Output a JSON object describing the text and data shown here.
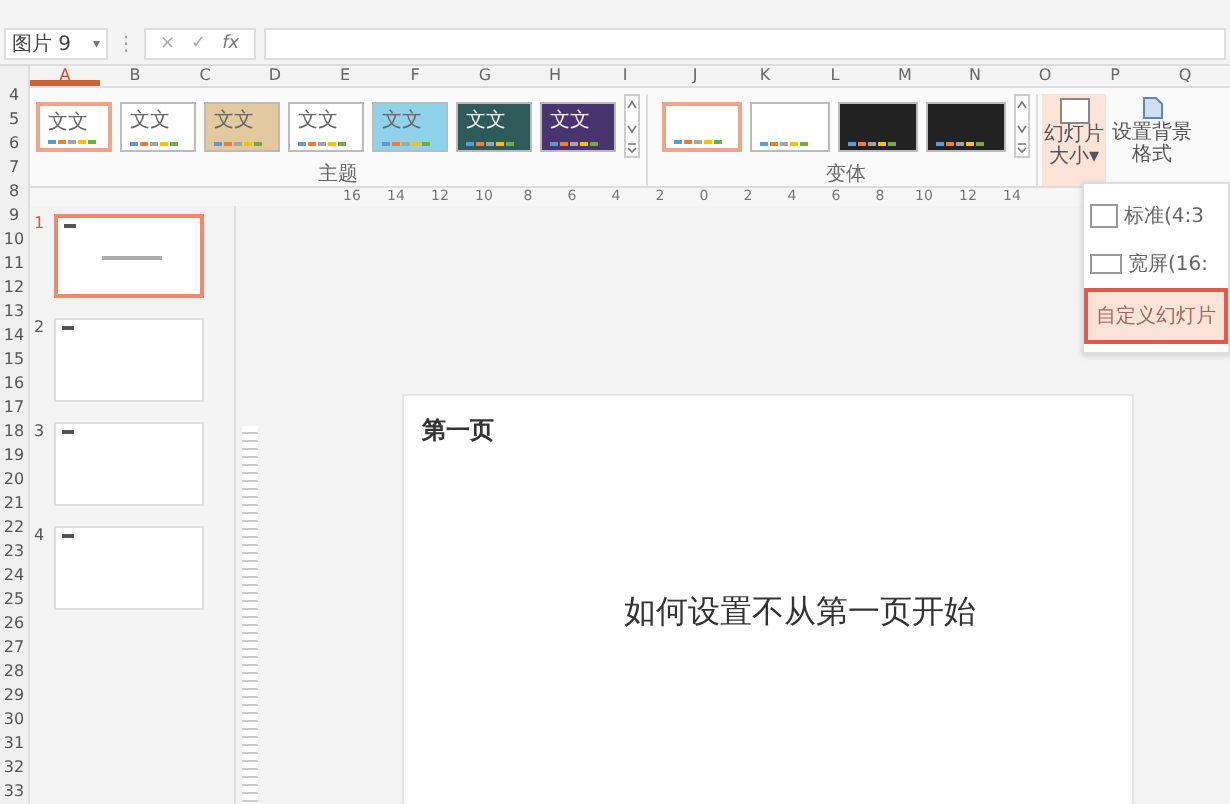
{
  "formula_bar": {
    "name_box": "图片 9",
    "name_box_caret": "▾",
    "separator": "⋮",
    "cancel": "×",
    "confirm": "✓",
    "function": "fx"
  },
  "columns": [
    {
      "label": "A",
      "selected": true
    },
    {
      "label": "B",
      "selected": false
    },
    {
      "label": "C",
      "selected": false
    },
    {
      "label": "D",
      "selected": false
    },
    {
      "label": "E",
      "selected": false
    },
    {
      "label": "F",
      "selected": false
    },
    {
      "label": "G",
      "selected": false
    },
    {
      "label": "H",
      "selected": false
    },
    {
      "label": "I",
      "selected": false
    },
    {
      "label": "J",
      "selected": false
    },
    {
      "label": "K",
      "selected": false
    },
    {
      "label": "L",
      "selected": false
    },
    {
      "label": "M",
      "selected": false
    },
    {
      "label": "N",
      "selected": false
    },
    {
      "label": "O",
      "selected": false
    },
    {
      "label": "P",
      "selected": false
    },
    {
      "label": "Q",
      "selected": false
    }
  ],
  "rows": [
    "4",
    "5",
    "6",
    "7",
    "8",
    "9",
    "10",
    "11",
    "12",
    "13",
    "14",
    "15",
    "16",
    "17",
    "18",
    "19",
    "20",
    "21",
    "22",
    "23",
    "24",
    "25",
    "26",
    "27",
    "28",
    "29",
    "30",
    "31",
    "32",
    "33"
  ],
  "themes": {
    "label": "主题",
    "items": [
      {
        "text": "文文",
        "color": "#ffffff",
        "selected": true
      },
      {
        "text": "文文",
        "color": "#ffffff",
        "selected": false
      },
      {
        "text": "文文",
        "color": "#e2c9a0",
        "selected": false
      },
      {
        "text": "文文",
        "color": "#ffffff",
        "selected": false
      },
      {
        "text": "文文",
        "color": "#8fd3ea",
        "selected": false
      },
      {
        "text": "文文",
        "color": "#2f5a5a",
        "selected": false
      },
      {
        "text": "文文",
        "color": "#4a3470",
        "selected": false
      }
    ]
  },
  "variants": {
    "label": "变体",
    "items": [
      {
        "color": "#ffffff",
        "selected": true
      },
      {
        "color": "#ffffff",
        "selected": false
      },
      {
        "color": "#222222",
        "selected": false
      },
      {
        "color": "#222222",
        "selected": false
      }
    ]
  },
  "slide_size_button": "幻灯片大小▾",
  "background_button": "设置背景格式",
  "size_menu": [
    {
      "label": "标准(4:3",
      "selected": false
    },
    {
      "label": "宽屏(16:",
      "selected": false
    },
    {
      "label": "自定义幻灯片",
      "selected": true
    }
  ],
  "ruler": [
    "16",
    "14",
    "12",
    "10",
    "8",
    "6",
    "4",
    "2",
    "0",
    "2",
    "4",
    "6",
    "8",
    "10",
    "12",
    "14"
  ],
  "slides": [
    {
      "number": "1",
      "selected": true
    },
    {
      "number": "2",
      "selected": false
    },
    {
      "number": "3",
      "selected": false
    },
    {
      "number": "4",
      "selected": false
    }
  ],
  "slide": {
    "header": "第一页",
    "title": "如何设置不从第一页开始"
  }
}
